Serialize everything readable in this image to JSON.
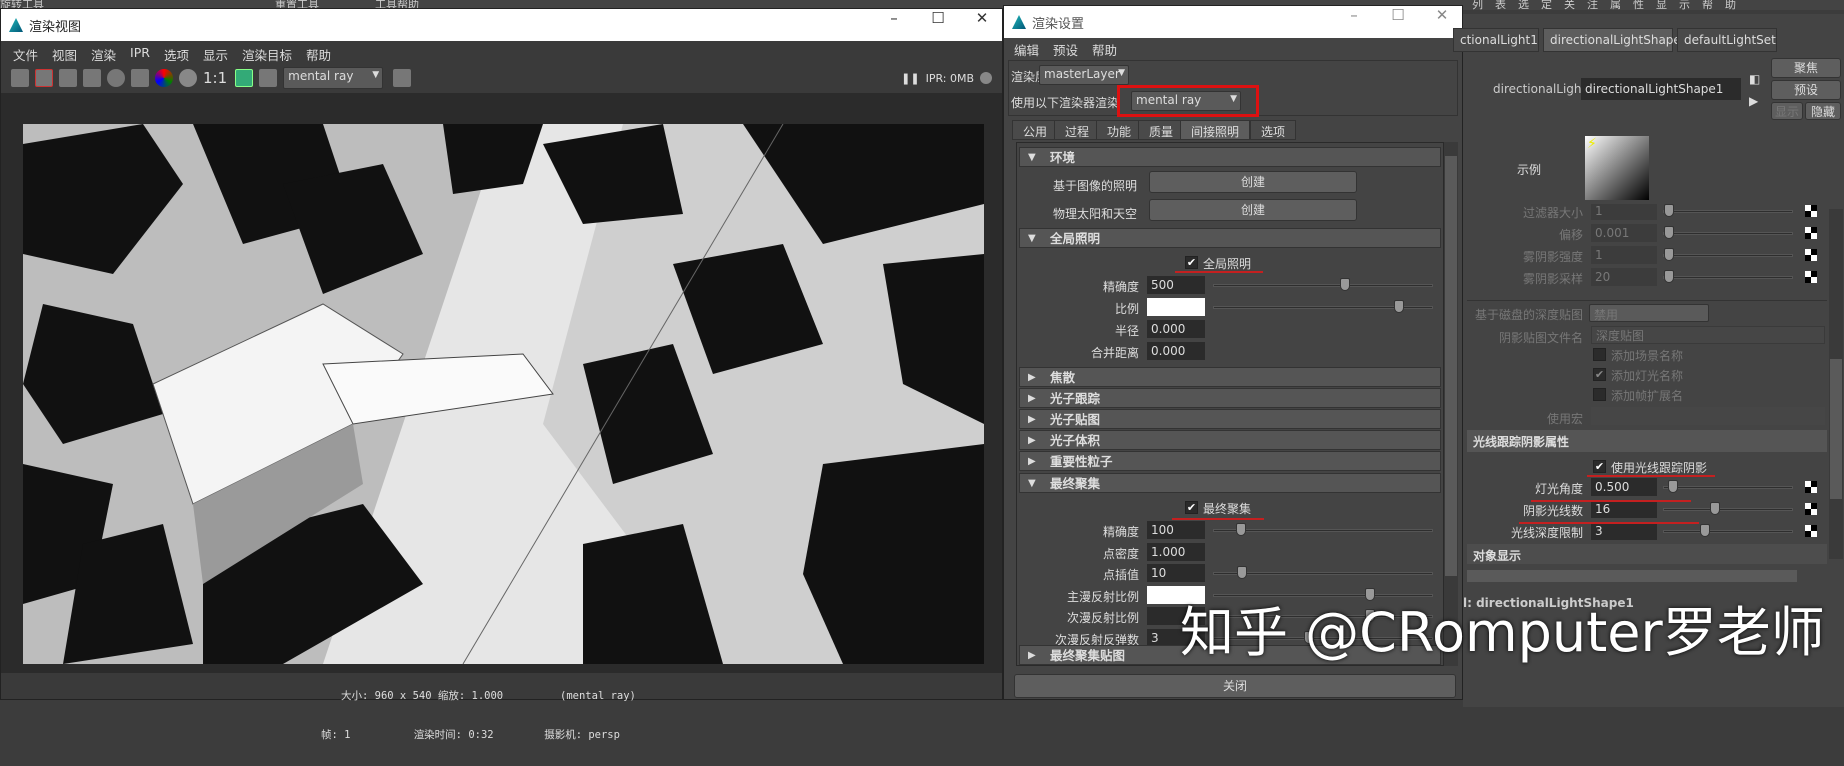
{
  "background": {
    "top_left": "旋转工具",
    "reset_tool": "重置工具",
    "tool_help": "工具帮助",
    "ae_menu": [
      "列表",
      "选定",
      "关注",
      "属性",
      "显示",
      "帮助"
    ]
  },
  "render_view": {
    "title": "渲染视图",
    "menu": [
      "文件",
      "视图",
      "渲染",
      "IPR",
      "选项",
      "显示",
      "渲染目标",
      "帮助"
    ],
    "ratio_label": "1:1",
    "renderer": "mental ray",
    "ipr_status": "IPR: 0MB",
    "status": {
      "size": "大小: 960 x 540 缩放: 1.000",
      "renderer": "(mental ray)",
      "frame": "帧: 1",
      "render_time": "渲染时间: 0:32",
      "camera": "摄影机: persp"
    }
  },
  "render_settings": {
    "title": "渲染设置",
    "menu": [
      "编辑",
      "预设",
      "帮助"
    ],
    "render_layer_label": "渲染层",
    "render_layer": "masterLayer",
    "renderer_label": "使用以下渲染器渲染",
    "renderer": "mental ray",
    "tabs": [
      "公用",
      "过程",
      "功能",
      "质量",
      "间接照明",
      "选项"
    ],
    "active_tab": "间接照明",
    "env_header": "环境",
    "ibl_label": "基于图像的照明",
    "sun_sky_label": "物理太阳和天空",
    "create_label": "创建",
    "gi_header": "全局照明",
    "gi_checkbox": "全局照明",
    "gi_rows": [
      {
        "label": "精确度",
        "value": "500",
        "slider": 0.7
      },
      {
        "label": "比例",
        "value": "",
        "color": "#ffffff",
        "slider": 1.0
      },
      {
        "label": "半径",
        "value": "0.000"
      },
      {
        "label": "合并距离",
        "value": "0.000"
      }
    ],
    "collapsed_sections": [
      "焦散",
      "光子跟踪",
      "光子贴图",
      "光子体积",
      "重要性粒子"
    ],
    "fg_header": "最终聚集",
    "fg_checkbox": "最终聚集",
    "fg_rows": [
      {
        "label": "精确度",
        "value": "100",
        "slider": 0.12
      },
      {
        "label": "点密度",
        "value": "1.000"
      },
      {
        "label": "点插值",
        "value": "10",
        "slider": 0.13
      },
      {
        "label": "主漫反射比例",
        "value": "",
        "color": "#ffffff",
        "slider": 0.84
      },
      {
        "label": "次漫反射比例",
        "value": "",
        "slider": 0.84
      },
      {
        "label": "次漫反射反弹数",
        "value": "3",
        "slider": 0.5
      }
    ],
    "fg_map_header": "最终聚集贴图",
    "close_label": "关闭"
  },
  "attribute_editor": {
    "tabs": [
      "ctionalLight1",
      "directionalLightShape1",
      "defaultLightSet"
    ],
    "active_tab": "directionalLightShape1",
    "buttons": {
      "focus": "聚焦",
      "presets": "预设",
      "show": "显示",
      "hide": "隐藏"
    },
    "node_label": "directionalLight:",
    "node_name": "directionalLightShape1",
    "sample_label": "示例",
    "dim_rows": [
      {
        "label": "过滤器大小",
        "value": "1"
      },
      {
        "label": "偏移",
        "value": "0.001"
      },
      {
        "label": "雾阴影强度",
        "value": "1"
      },
      {
        "label": "雾阴影采样",
        "value": "20"
      }
    ],
    "disk_depth_label": "基于磁盘的深度贴图",
    "disk_depth_value": "禁用",
    "shadow_file_label": "阴影贴图文件名",
    "shadow_file_value": "深度贴图",
    "checks": [
      {
        "label": "添加场景名称",
        "checked": false
      },
      {
        "label": "添加灯光名称",
        "checked": true
      },
      {
        "label": "添加帧扩展名",
        "checked": false
      }
    ],
    "macro_label": "使用宏",
    "rt_header": "光线跟踪阴影属性",
    "rt_checkbox": "使用光线跟踪阴影",
    "rt_rows": [
      {
        "label": "灯光角度",
        "value": "0.500",
        "slider": 0.03
      },
      {
        "label": "阴影光线数",
        "value": "16",
        "slider": 0.38
      },
      {
        "label": "光线深度限制",
        "value": "3",
        "slider": 0.3
      }
    ],
    "object_display_header": "对象显示",
    "footer": "l: directionalLightShape1"
  },
  "watermark": "知乎 @CRomputer罗老师"
}
